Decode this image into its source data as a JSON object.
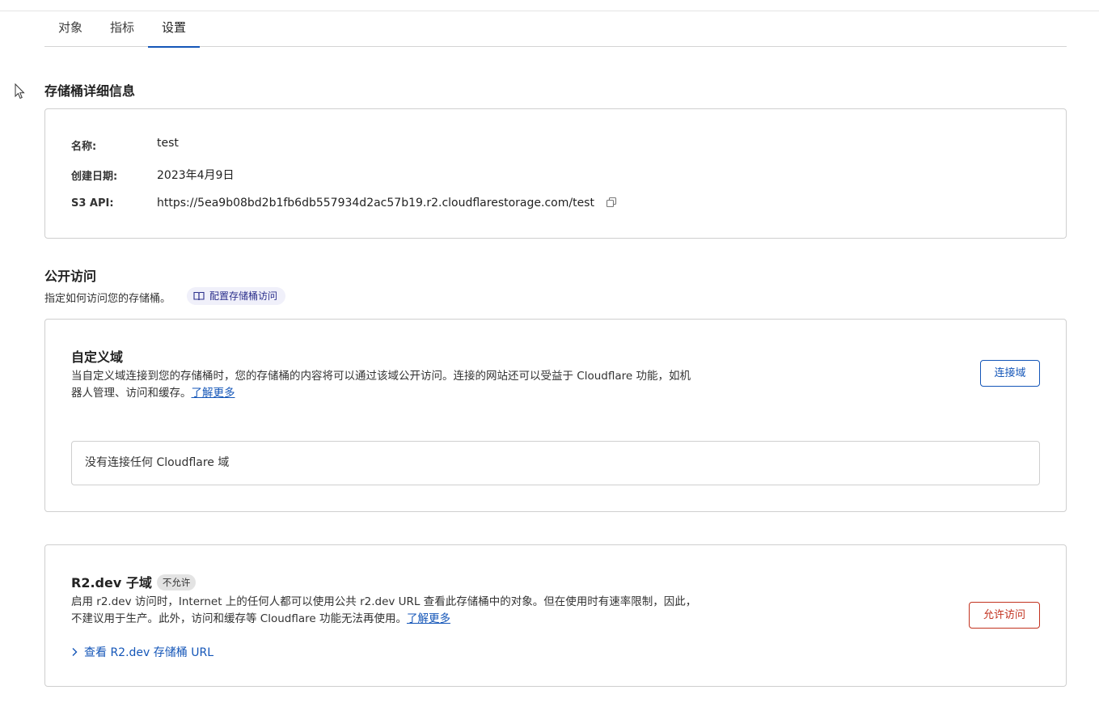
{
  "tabs": [
    {
      "label": "对象"
    },
    {
      "label": "指标"
    },
    {
      "label": "设置",
      "active": true
    }
  ],
  "bucket_details": {
    "title": "存储桶详细信息",
    "name_key": "名称:",
    "name_value": "test",
    "date_key": "创建日期:",
    "date_value": "2023年4月9日",
    "api_key": "S3 API:",
    "api_value": "https://5ea9b08bd2b1fb6db557934d2ac57b19.r2.cloudflarestorage.com/test",
    "copy_icon": "copy-icon"
  },
  "public_access": {
    "title": "公开访问",
    "subtitle": "指定如何访问您的存储桶。",
    "doc_link": "配置存储桶访问",
    "doc_icon": "book-icon"
  },
  "custom_domain": {
    "title": "自定义域",
    "desc_line1": "当自定义域连接到您的存储桶时，您的存储桶的内容将可以通过该域公开访问。连接的网站还可以受益于 Cloudflare 功能，如机",
    "desc_line2": "器人管理、访问和缓存。",
    "learn_more": "了解更多",
    "connect_button": "连接域",
    "empty_text": "没有连接任何 Cloudflare 域"
  },
  "r2dev": {
    "title": "R2.dev 子域",
    "badge": "不允许",
    "desc_line1": "启用 r2.dev 访问时，Internet 上的任何人都可以使用公共 r2.dev URL 查看此存储桶中的对象。但在使用时有速率限制，因此，",
    "desc_line2": "不建议用于生产。此外，访问和缓存等 Cloudflare 功能无法再使用。",
    "learn_more": "了解更多",
    "allow_button": "允许访问",
    "expander": "查看 R2.dev 存储桶 URL"
  },
  "colors": {
    "accent": "#1456b8",
    "danger": "#c2321f",
    "border": "#cfcfcf"
  }
}
